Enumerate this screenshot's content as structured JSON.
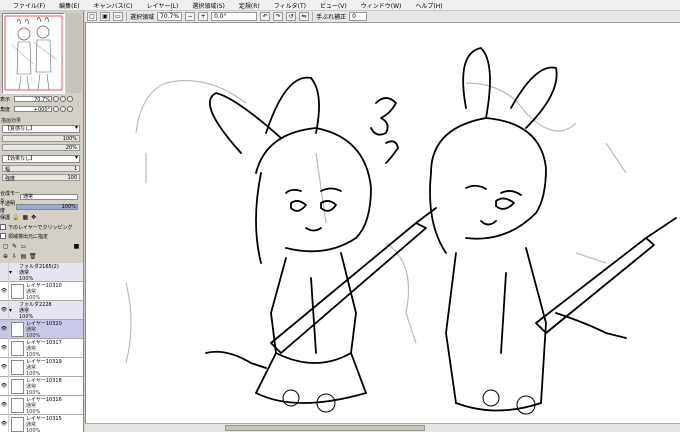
{
  "menu": [
    "ファイル(F)",
    "編集(E)",
    "キャンバス(C)",
    "レイヤー(L)",
    "選択領域(S)",
    "定規(R)",
    "フィルタ(T)",
    "ビュー(V)",
    "ウィンドウ(W)",
    "ヘルプ(H)"
  ],
  "toolbar": {
    "selection_label": "選択領域",
    "zoom": "70.7%",
    "angle": "0.0°",
    "stabilizer_label": "手ぶれ補正",
    "stabilizer_value": "0"
  },
  "navigator": {
    "zoom_label": "表示",
    "zoom_value": "70.7%",
    "angle_label": "角度",
    "angle_value": "+000°"
  },
  "panel": {
    "effect_label": "描画効果",
    "texture_value": "【質感なし】",
    "pct1": "100%",
    "pct2": "20%",
    "effect_value": "【効果なし】",
    "width_label": "幅",
    "width_value": "1",
    "strength_label": "強度",
    "strength_value": "100",
    "mode_label": "合成モード",
    "mode_value": "通常",
    "opacity_label": "不透明度",
    "opacity_value": "100%",
    "protect_label": "保護",
    "clip_label": "下のレイヤーでクリッピング",
    "source_label": "領域検出元に指定"
  },
  "layers": [
    {
      "name": "フォルダ2165(2)",
      "mode": "通常",
      "opacity": "100%",
      "type": "folder"
    },
    {
      "name": "レイヤー10310",
      "mode": "通常",
      "opacity": "100%",
      "type": "layer"
    },
    {
      "name": "フォルダ2228",
      "mode": "通常",
      "opacity": "100%",
      "type": "folder"
    },
    {
      "name": "レイヤー10320",
      "mode": "通常",
      "opacity": "100%",
      "type": "layer",
      "selected": true
    },
    {
      "name": "レイヤー10317",
      "mode": "通常",
      "opacity": "100%",
      "type": "layer"
    },
    {
      "name": "レイヤー10319",
      "mode": "通常",
      "opacity": "100%",
      "type": "layer"
    },
    {
      "name": "レイヤー10318",
      "mode": "通常",
      "opacity": "100%",
      "type": "layer"
    },
    {
      "name": "レイヤー10316",
      "mode": "通常",
      "opacity": "100%",
      "type": "layer"
    },
    {
      "name": "レイヤー10315",
      "mode": "通常",
      "opacity": "100%",
      "type": "layer"
    }
  ]
}
